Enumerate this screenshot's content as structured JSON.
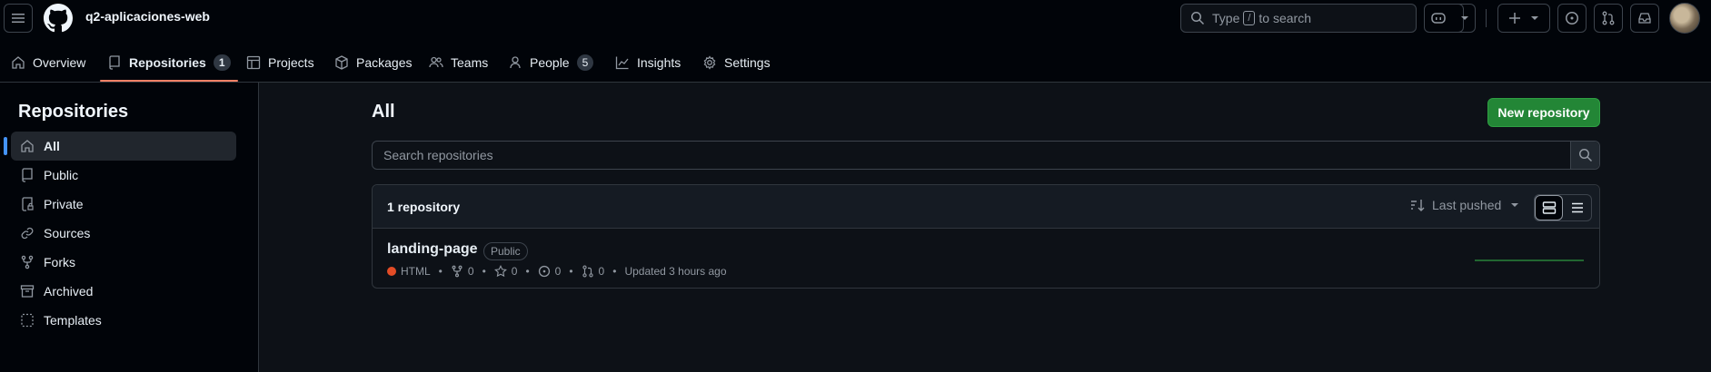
{
  "header": {
    "org_name": "q2-aplicaciones-web",
    "search": {
      "prefix": "Type",
      "key": "/",
      "suffix": "to search"
    }
  },
  "tabs": [
    {
      "label": "Overview",
      "icon": "home-icon"
    },
    {
      "label": "Repositories",
      "icon": "repo-icon",
      "count": "1",
      "selected": true
    },
    {
      "label": "Projects",
      "icon": "table-icon"
    },
    {
      "label": "Packages",
      "icon": "package-icon"
    },
    {
      "label": "Teams",
      "icon": "people-icon"
    },
    {
      "label": "People",
      "icon": "person-icon",
      "count": "5"
    },
    {
      "label": "Insights",
      "icon": "graph-icon"
    },
    {
      "label": "Settings",
      "icon": "gear-icon"
    }
  ],
  "sidebar": {
    "title": "Repositories",
    "items": [
      {
        "label": "All",
        "icon": "home-icon",
        "active": true
      },
      {
        "label": "Public",
        "icon": "repo-icon"
      },
      {
        "label": "Private",
        "icon": "lock-repo-icon"
      },
      {
        "label": "Sources",
        "icon": "link-icon"
      },
      {
        "label": "Forks",
        "icon": "fork-icon"
      },
      {
        "label": "Archived",
        "icon": "archive-icon"
      },
      {
        "label": "Templates",
        "icon": "template-icon"
      }
    ]
  },
  "main": {
    "title": "All",
    "new_repo_label": "New repository",
    "search_placeholder": "Search repositories",
    "repo_count": "1 repository",
    "sort_label": "Last pushed",
    "repos": [
      {
        "name": "landing-page",
        "visibility": "Public",
        "language": "HTML",
        "language_color": "#e34c26",
        "forks": "0",
        "stars": "0",
        "issues": "0",
        "pulls": "0",
        "updated": "Updated 3 hours ago"
      }
    ]
  },
  "colors": {
    "accent": "#f78166",
    "primary_button": "#238636",
    "active_marker": "#4493f8"
  }
}
